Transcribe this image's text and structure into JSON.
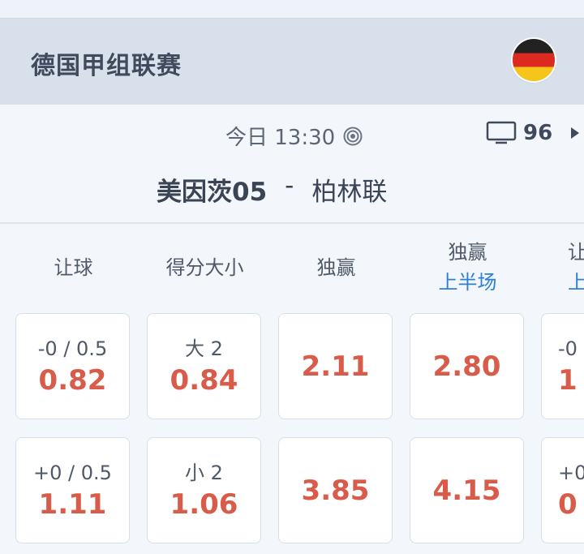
{
  "league": {
    "name": "德国甲组联赛",
    "flag": "germany-flag"
  },
  "match": {
    "time": "今日 13:30",
    "tv_count": "96",
    "home_team": "美因茨05",
    "separator": "-",
    "away_team": "柏林联"
  },
  "columns": [
    {
      "title": "让球",
      "subtitle": ""
    },
    {
      "title": "得分大小",
      "subtitle": ""
    },
    {
      "title": "独赢",
      "subtitle": ""
    },
    {
      "title": "独赢",
      "subtitle": "上半场"
    },
    {
      "title": "让",
      "subtitle": "上"
    }
  ],
  "rows": [
    [
      {
        "line": "-0 / 0.5",
        "odds": "0.82"
      },
      {
        "line": "大 2",
        "odds": "0.84"
      },
      {
        "line": "",
        "odds": "2.11"
      },
      {
        "line": "",
        "odds": "2.80"
      },
      {
        "line": "-0",
        "odds": "1"
      }
    ],
    [
      {
        "line": "+0 / 0.5",
        "odds": "1.11"
      },
      {
        "line": "小 2",
        "odds": "1.06"
      },
      {
        "line": "",
        "odds": "3.85"
      },
      {
        "line": "",
        "odds": "4.15"
      },
      {
        "line": "+0",
        "odds": "0"
      }
    ]
  ],
  "colors": {
    "odds": "#d95b49",
    "accent": "#2f7fd6",
    "header_bg": "#d8e0eb"
  },
  "icons": {
    "live": "live-broadcast-icon",
    "tv": "tv-icon",
    "more": "chevron-right-icon"
  }
}
